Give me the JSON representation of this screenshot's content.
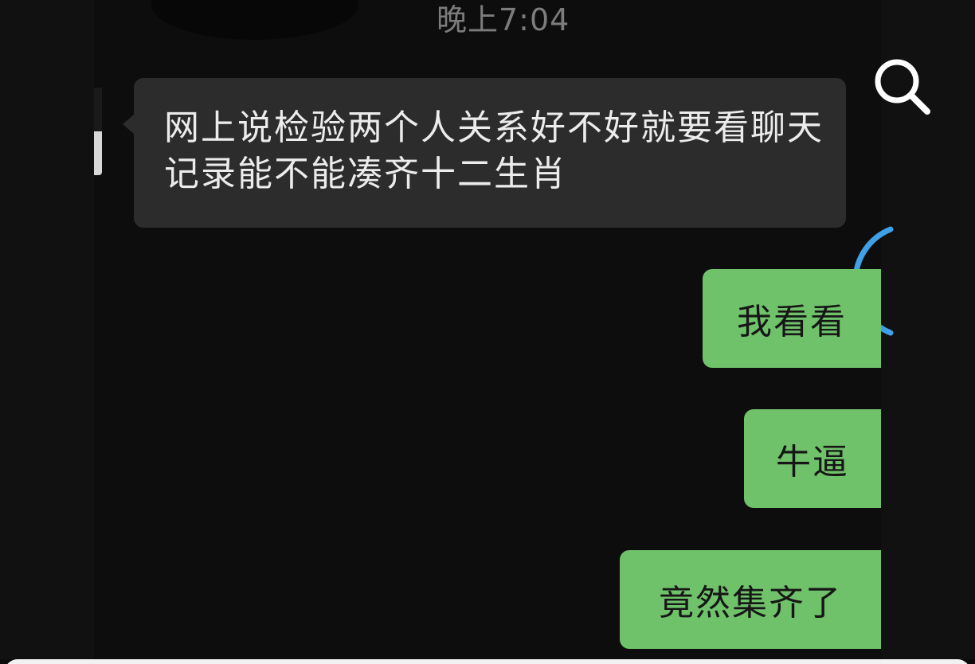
{
  "header": {
    "timestamp": "晚上7:04"
  },
  "toolbar": {
    "search_icon": "search-icon"
  },
  "messages": [
    {
      "side": "incoming",
      "text": "网上说检验两个人关系好不好就要看聊天记录能不能凑齐十二生肖"
    },
    {
      "side": "outgoing",
      "text": "我看看"
    },
    {
      "side": "outgoing",
      "text": "牛逼"
    },
    {
      "side": "outgoing",
      "text": "竟然集齐了"
    }
  ],
  "colors": {
    "background": "#0d0d0d",
    "incoming_bubble": "#2c2c2c",
    "outgoing_bubble": "#6fc26a",
    "accent_arc": "#3fa0e8"
  }
}
